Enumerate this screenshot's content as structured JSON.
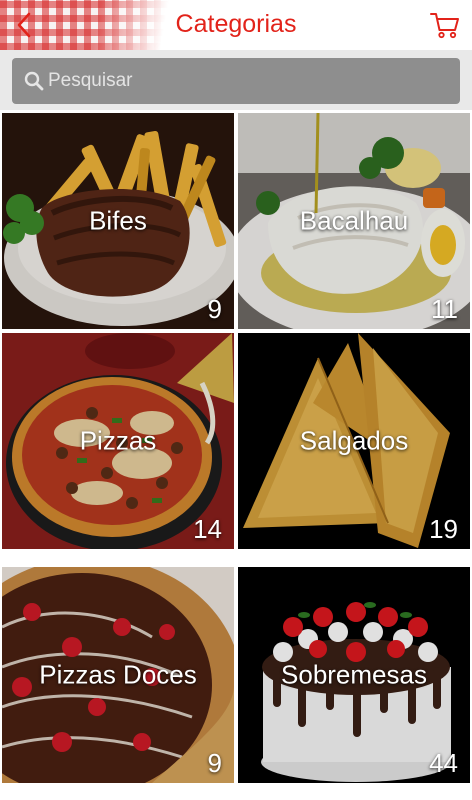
{
  "header": {
    "title": "Categorias",
    "back_icon": "chevron-left-icon",
    "cart_icon": "cart-icon",
    "accent_color": "#e2231a"
  },
  "search": {
    "placeholder": "Pesquisar",
    "value": "",
    "icon": "search-icon"
  },
  "categories": [
    {
      "name": "Bifes",
      "count": "9"
    },
    {
      "name": "Bacalhau",
      "count": "11"
    },
    {
      "name": "Pizzas",
      "count": "14"
    },
    {
      "name": "Salgados",
      "count": "19"
    },
    {
      "name": "Pizzas Doces",
      "count": "9"
    },
    {
      "name": "Sobremesas",
      "count": "44"
    }
  ]
}
